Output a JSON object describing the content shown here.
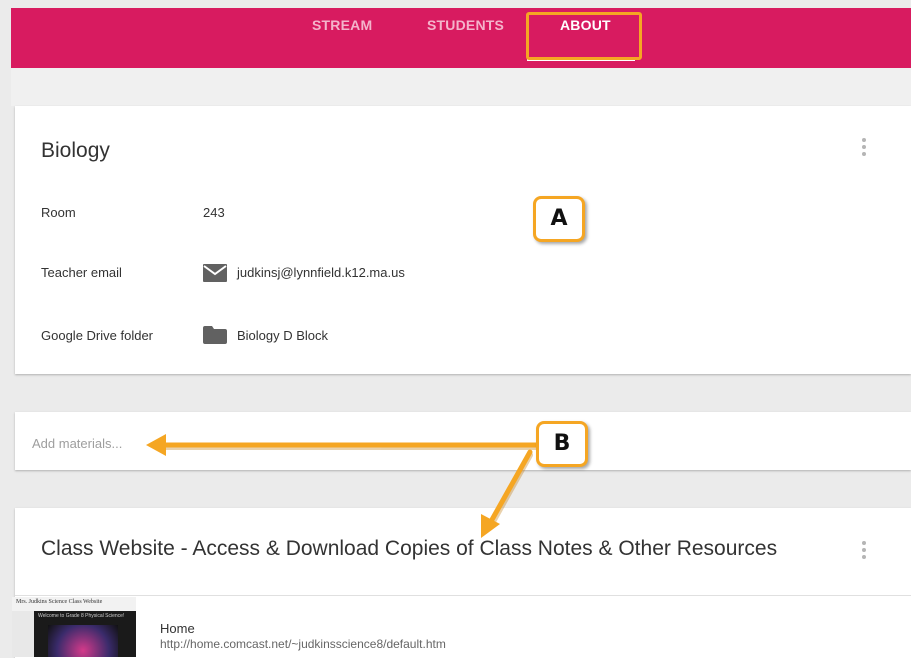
{
  "tabs": [
    {
      "label": "STREAM",
      "active": false
    },
    {
      "label": "STUDENTS",
      "active": false
    },
    {
      "label": "ABOUT",
      "active": true
    }
  ],
  "class_card": {
    "title": "Biology",
    "rows": [
      {
        "label": "Room",
        "value": "243",
        "icon": ""
      },
      {
        "label": "Teacher email",
        "value": "judkinsj@lynnfield.k12.ma.us",
        "icon": "mail-icon"
      },
      {
        "label": "Google Drive folder",
        "value": "Biology D Block",
        "icon": "folder-icon"
      }
    ]
  },
  "materials": {
    "placeholder": "Add materials..."
  },
  "resource_card": {
    "title": "Class Website - Access & Download Copies of Class Notes & Other Resources",
    "link": {
      "title": "Home",
      "url": "http://home.comcast.net/~judkinsscience8/default.htm"
    },
    "thumbnail_header": "Mrs. Judkins Science Class Website",
    "thumbnail_sub": "Welcome to Grade 8 Physical Science!"
  },
  "callouts": {
    "a": "A",
    "b": "B"
  },
  "colors": {
    "header": "#d81b60",
    "callout_border": "#f5a623",
    "arrow": "#f5a623"
  }
}
